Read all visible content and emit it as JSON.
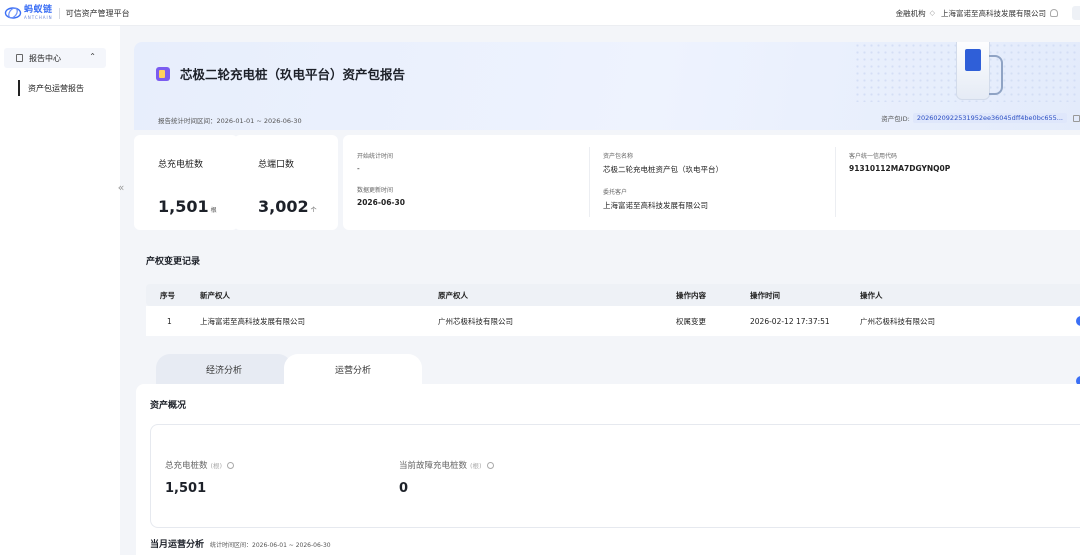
{
  "topbar": {
    "logo_cn": "蚂蚁链",
    "logo_en": "ANTCHAIN",
    "platform": "可信资产管理平台",
    "org_label": "金融机构",
    "company": "上海富诺至高科技发展有限公司"
  },
  "sidebar": {
    "group_label": "报告中心",
    "items": [
      {
        "label": "资产包运营报告"
      }
    ]
  },
  "report": {
    "title": "芯极二轮充电桩（玖电平台）资产包报告",
    "period": "报告统计时间区间：2026-01-01 ~ 2026-06-30",
    "asset_id_label": "资产包ID:",
    "asset_id": "2026020922531952ee36045dff4be0bc655..."
  },
  "stats": {
    "piles": {
      "label": "总充电桩数",
      "value": "1,501",
      "unit": "根"
    },
    "ports": {
      "label": "总端口数",
      "value": "3,002",
      "unit": "个"
    }
  },
  "info": {
    "start_time_label": "开始统计时间",
    "start_time": "-",
    "update_time_label": "数据更新时间",
    "update_time": "2026-06-30",
    "pkg_name_label": "资产包名称",
    "pkg_name": "芯极二轮充电桩资产包（玖电平台）",
    "client_label": "委托客户",
    "client": "上海富诺至高科技发展有限公司",
    "credit_code_label": "客户统一信用代码",
    "credit_code": "91310112MA7DGYNQ0P"
  },
  "ownership": {
    "title": "产权变更记录",
    "headers": [
      "序号",
      "新产权人",
      "原产权人",
      "操作内容",
      "操作时间",
      "操作人"
    ],
    "rows": [
      [
        "1",
        "上海富诺至高科技发展有限公司",
        "广州芯极科技有限公司",
        "权属变更",
        "2026-02-12 17:37:51",
        "广州芯极科技有限公司"
      ]
    ]
  },
  "tabs": [
    {
      "label": "经济分析"
    },
    {
      "label": "运营分析"
    }
  ],
  "overview": {
    "title": "资产概况",
    "total_piles_label": "总充电桩数",
    "total_piles_unit": "(根)",
    "total_piles": "1,501",
    "fault_label": "当前故障充电桩数",
    "fault_unit": "(根)",
    "fault": "0"
  },
  "monthly": {
    "title": "当月运营分析",
    "period": "统计时间区间：2026-06-01 ~ 2026-06-30"
  }
}
